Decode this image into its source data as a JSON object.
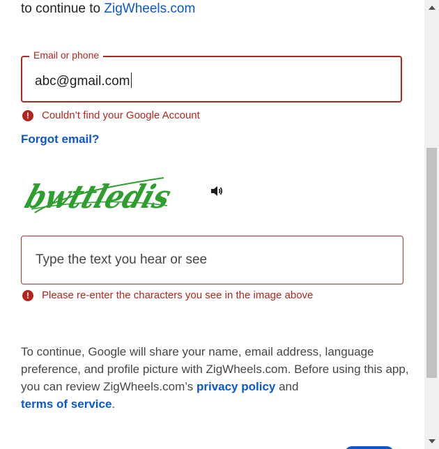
{
  "header": {
    "subtitle_prefix": "to continue to",
    "app_name": "ZigWheels.com"
  },
  "email_field": {
    "label": "Email or phone",
    "value": "abc@gmail.com",
    "error": "Couldn’t find your Google Account"
  },
  "forgot_email": "Forgot email?",
  "captcha": {
    "image_text": "bwttledis",
    "audio_icon": "speaker-icon"
  },
  "captcha_field": {
    "placeholder": "Type the text you hear or see",
    "error": "Please re-enter the characters you see in the image above"
  },
  "disclaimer": {
    "text_before": "To continue, Google will share your name, email address, language preference, and profile picture with ZigWheels.com. Before using this app, you can review ZigWheels.com’s",
    "privacy_link": "privacy policy",
    "and": "and",
    "terms_link": "terms of service",
    "period": "."
  },
  "colors": {
    "link": "#0b57d0",
    "error": "#b3261e",
    "captcha_green": "#2e9e2e"
  }
}
